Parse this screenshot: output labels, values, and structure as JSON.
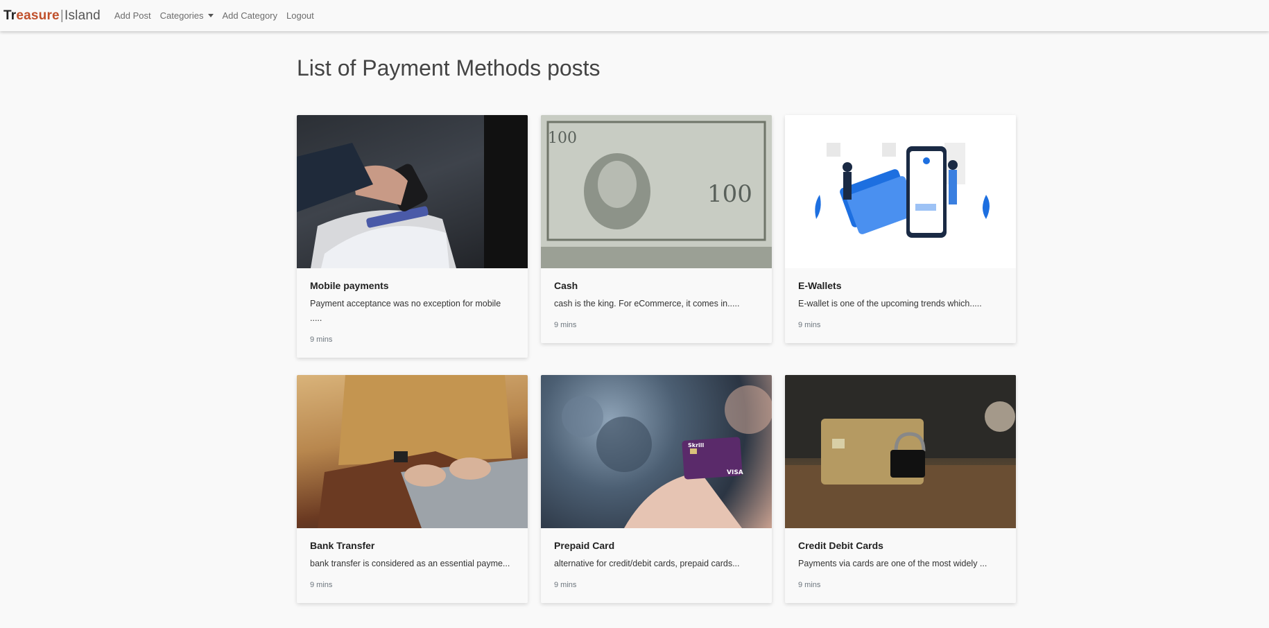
{
  "brand": {
    "part1": "Tr",
    "part2": "easure",
    "part3": "",
    "separator": "|",
    "part4": "Island"
  },
  "nav": {
    "items": [
      {
        "label": "Add Post"
      },
      {
        "label": "Categories"
      },
      {
        "label": "Add Category"
      },
      {
        "label": "Logout"
      }
    ]
  },
  "page": {
    "title": "List of Payment Methods posts"
  },
  "posts": [
    {
      "title": "Mobile payments",
      "excerpt": "Payment acceptance was no exception for mobile .....",
      "time": "9 mins",
      "image": "mobile-payment-terminal-photo"
    },
    {
      "title": "Cash",
      "excerpt": "cash is the king. For eCommerce, it comes in.....",
      "time": "9 mins",
      "image": "dollar-bills-photo"
    },
    {
      "title": "E-Wallets",
      "excerpt": "E-wallet is one of the upcoming trends which.....",
      "time": "9 mins",
      "image": "ewallet-illustration"
    },
    {
      "title": "Bank Transfer",
      "excerpt": "bank transfer is considered as an essential payme...",
      "time": "9 mins",
      "image": "laptop-typing-photo"
    },
    {
      "title": "Prepaid Card",
      "excerpt": "alternative for credit/debit cards, prepaid cards...",
      "time": "9 mins",
      "image": "prepaid-card-photo"
    },
    {
      "title": "Credit Debit Cards",
      "excerpt": "Payments via cards are one of the most widely ...",
      "time": "9 mins",
      "image": "credit-card-lock-photo"
    }
  ],
  "colors": {
    "background": "#f9f9f9",
    "brand_accent": "#c0502b",
    "title": "#444444",
    "muted": "#6c757d"
  }
}
